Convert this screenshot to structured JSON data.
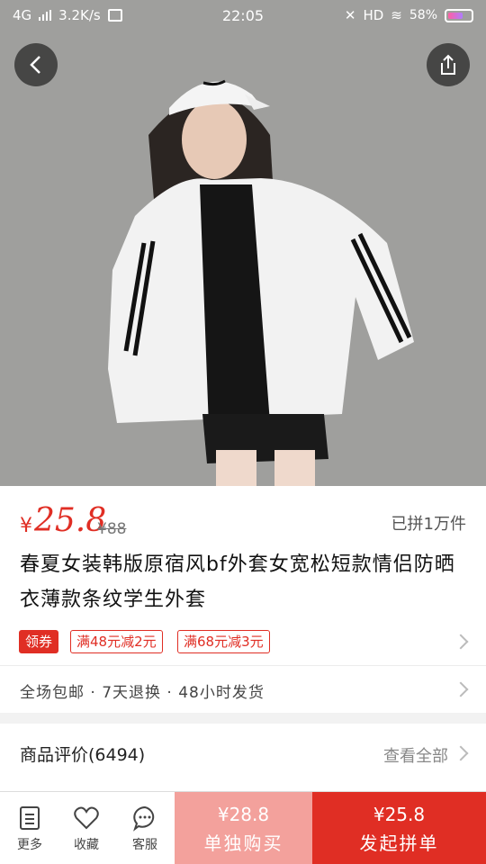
{
  "status_bar": {
    "network": "4G",
    "speed": "3.2K/s",
    "time": "22:05",
    "hd": "HD",
    "battery": "58%"
  },
  "colors": {
    "accent": "#e02e24",
    "accent_light": "#f3a19c"
  },
  "product": {
    "currency": "¥",
    "price": "25.8",
    "original_price": "¥88",
    "sold": "已拼1万件",
    "title": "春夏女装韩版原宿风bf外套女宽松短款情侣防晒衣薄款条纹学生外套"
  },
  "coupons": {
    "main_label": "领券",
    "items": [
      "满48元减2元",
      "满68元减3元"
    ]
  },
  "services": "全场包邮 · 7天退换 · 48小时发货",
  "reviews": {
    "title": "商品评价(6494)",
    "view_all": "查看全部"
  },
  "bottom_bar": {
    "more": "更多",
    "favorite": "收藏",
    "service": "客服",
    "single_price": "¥28.8",
    "single_label": "单独购买",
    "group_price": "¥25.8",
    "group_label": "发起拼单"
  },
  "icons": [
    "back-icon",
    "share-icon",
    "more-icon",
    "favorite-icon",
    "service-icon"
  ]
}
